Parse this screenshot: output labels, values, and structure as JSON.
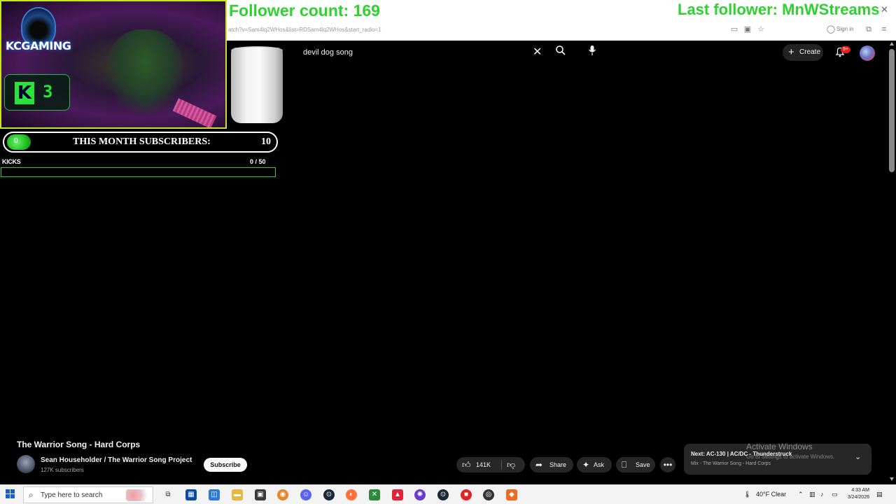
{
  "browser": {
    "url": "atch?v=Sam4lq2WHos&list=RDSam4lq2WHos&start_radio=1",
    "signin_label": "Sign in",
    "close_glyph": "✕"
  },
  "overlay": {
    "follower_count": "Follower count: 169",
    "last_follower": "Last follower: MnWStreams",
    "logo_text": "KCGAMING",
    "kick_letter": "K",
    "kick_count": "3",
    "subs_dot": "0",
    "subs_label": "THIS MONTH SUBSCRIBERS:",
    "subs_value": "10",
    "kicks_label": "KICKS",
    "kicks_value": "0 / 50",
    "kicks_progress": 0,
    "accent_color": "#2fd12f"
  },
  "youtube": {
    "search_query": "devil dog song",
    "create_label": "Create",
    "notifications_badge": "9+",
    "video": {
      "title": "The Warrior Song - Hard Corps",
      "channel": "Sean Householder / The Warrior Song Project",
      "subscribers": "127K subscribers",
      "subscribe_label": "Subscribe"
    },
    "actions": {
      "likes": "141K",
      "share_label": "Share",
      "ask_label": "Ask",
      "save_label": "Save"
    },
    "up_next": {
      "title": "Next: AC-130 | AC/DC - Thunderstruck",
      "subtitle": "Mix - The Warrior Song - Hard Corps"
    }
  },
  "watermark": {
    "title": "Activate Windows",
    "subtitle": "Go to Settings to activate Windows."
  },
  "taskbar": {
    "search_placeholder": "Type here to search",
    "weather": "40°F  Clear",
    "time": "4:33 AM",
    "date": "3/24/2026",
    "icons": [
      "task-view-icon",
      "store-icon",
      "photos-icon",
      "file-explorer-icon",
      "vpn-icon",
      "browser-icon",
      "discord-icon",
      "steam-icon",
      "firefox-icon",
      "xbox-icon",
      "adobe-icon",
      "app-icon",
      "steam-icon-2",
      "roblox-icon",
      "chrome-icon",
      "brave-icon"
    ]
  }
}
